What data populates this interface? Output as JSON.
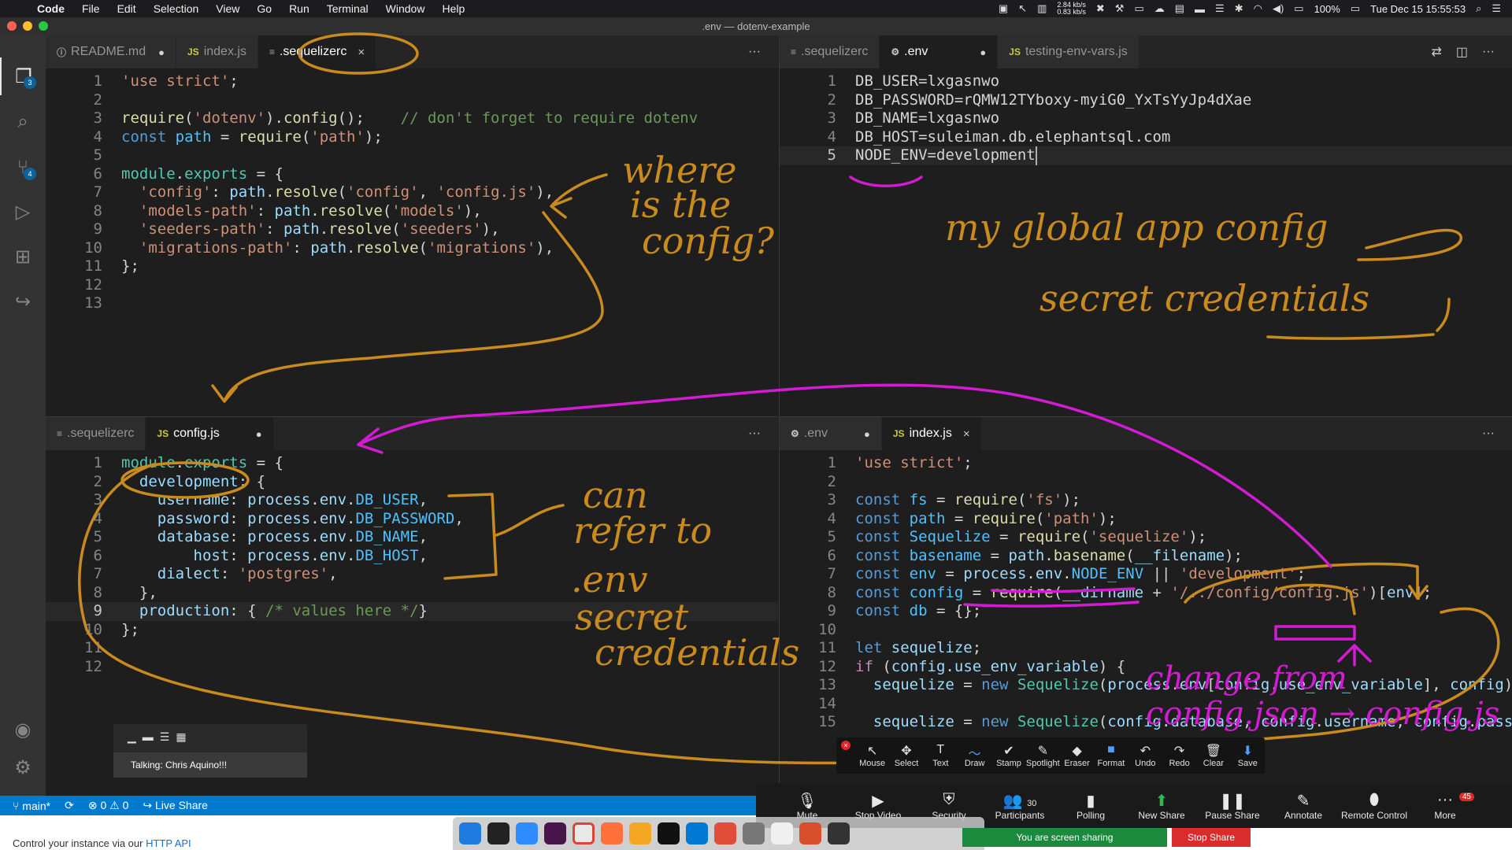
{
  "menubar": {
    "app_name": "Code",
    "items": [
      "File",
      "Edit",
      "Selection",
      "View",
      "Go",
      "Run",
      "Terminal",
      "Window",
      "Help"
    ],
    "net_up": "2.84 kb/s",
    "net_down": "0.83 kb/s",
    "battery": "100%",
    "datetime": "Tue Dec 15  15:55:53"
  },
  "window": {
    "title": ".env — dotenv-example"
  },
  "activity": {
    "explorer_badge": "3",
    "scm_badge": "4"
  },
  "groups": {
    "top_left": {
      "tabs": [
        {
          "label": "README.md",
          "type": "md",
          "mod": "●"
        },
        {
          "label": "index.js",
          "type": "JS"
        },
        {
          "label": ".sequelizerc",
          "type": "≡",
          "close": "×"
        }
      ],
      "more": "···"
    },
    "top_right": {
      "tabs": [
        {
          "label": ".sequelizerc",
          "type": "≡"
        },
        {
          "label": ".env",
          "type": "⚙",
          "mod": "●"
        },
        {
          "label": "testing-env-vars.js",
          "type": "JS"
        }
      ],
      "more": "···"
    },
    "bottom_left": {
      "tabs": [
        {
          "label": ".sequelizerc",
          "type": "≡"
        },
        {
          "label": "config.js",
          "type": "JS",
          "mod": "●"
        }
      ],
      "more": "···"
    },
    "bottom_right": {
      "tabs": [
        {
          "label": ".env",
          "type": "⚙",
          "mod": "●"
        },
        {
          "label": "index.js",
          "type": "JS",
          "close": "×"
        }
      ],
      "more": "···"
    }
  },
  "code": {
    "sequelizerc": [
      "'use strict';",
      "",
      "require('dotenv').config();    // don't forget to require dotenv",
      "const path = require('path');",
      "",
      "module.exports = {",
      "  'config': path.resolve('config', 'config.js'),",
      "  'models-path': path.resolve('models'),",
      "  'seeders-path': path.resolve('seeders'),",
      "  'migrations-path': path.resolve('migrations'),",
      "};",
      "",
      ""
    ],
    "env": [
      "DB_USER=lxgasnwo",
      "DB_PASSWORD=rQMW12TYboxy-myiG0_YxTsYyJp4dXae",
      "DB_NAME=lxgasnwo",
      "DB_HOST=suleiman.db.elephantsql.com",
      "NODE_ENV=development"
    ],
    "config": [
      "module.exports = {",
      "  development: {",
      "    username: process.env.DB_USER,",
      "    password: process.env.DB_PASSWORD,",
      "    database: process.env.DB_NAME,",
      "        host: process.env.DB_HOST,",
      "    dialect: 'postgres',",
      "  },",
      "  production: { /* values here */}",
      "};",
      "",
      ""
    ],
    "index": [
      "'use strict';",
      "",
      "const fs = require('fs');",
      "const path = require('path');",
      "const Sequelize = require('sequelize');",
      "const basename = path.basename(__filename);",
      "const env = process.env.NODE_ENV || 'development';",
      "const config = require(__dirname + '/../config/config.js')[env];",
      "const db = {};",
      "",
      "let sequelize;",
      "if (config.use_env_variable) {",
      "  sequelize = new Sequelize(process.env[config.use_env_variable], config);",
      "",
      "  sequelize = new Sequelize(config.database, config.username, config.pass"
    ]
  },
  "statusbar": {
    "branch": "main*",
    "errors": "0",
    "warnings": "0",
    "live_share": "Live Share"
  },
  "annotate_toolbar": [
    {
      "label": "Mouse",
      "icon": "↖"
    },
    {
      "label": "Select",
      "icon": "✥"
    },
    {
      "label": "Text",
      "icon": "T"
    },
    {
      "label": "Draw",
      "icon": "〜"
    },
    {
      "label": "Stamp",
      "icon": "✔"
    },
    {
      "label": "Spotlight",
      "icon": "✎"
    },
    {
      "label": "Eraser",
      "icon": "◆"
    },
    {
      "label": "Format",
      "icon": "■"
    },
    {
      "label": "Undo",
      "icon": "↶"
    },
    {
      "label": "Redo",
      "icon": "↷"
    },
    {
      "label": "Clear",
      "icon": "🗑"
    },
    {
      "label": "Save",
      "icon": "⬇"
    }
  ],
  "zoom_toolbar": {
    "mute": "Mute",
    "stop_video": "Stop Video",
    "security": "Security",
    "participants": "Participants",
    "participants_count": "30",
    "polling": "Polling",
    "new_share": "New Share",
    "pause_share": "Pause Share",
    "annotate": "Annotate",
    "remote_control": "Remote Control",
    "more": "More",
    "more_badge": "45"
  },
  "talking": {
    "label": "Talking: Chris Aquino!!!"
  },
  "sharing": {
    "status": "You are screen sharing",
    "stop": "Stop Share"
  },
  "bottom_text": {
    "prefix": "Control your instance via our ",
    "link": "HTTP API"
  },
  "annotations": {
    "config_question": [
      "where",
      "is the",
      "config?"
    ],
    "env_note": [
      "my global app config",
      "secret credentials"
    ],
    "refer_note": [
      "can",
      "refer to",
      ".env",
      "secret",
      "credentials"
    ],
    "change_note": [
      "change from",
      "config.json → config.js"
    ]
  },
  "colors": {
    "ink_orange": "#c98a1e",
    "ink_magenta": "#d21bd2",
    "vscode_blue": "#007acc"
  }
}
